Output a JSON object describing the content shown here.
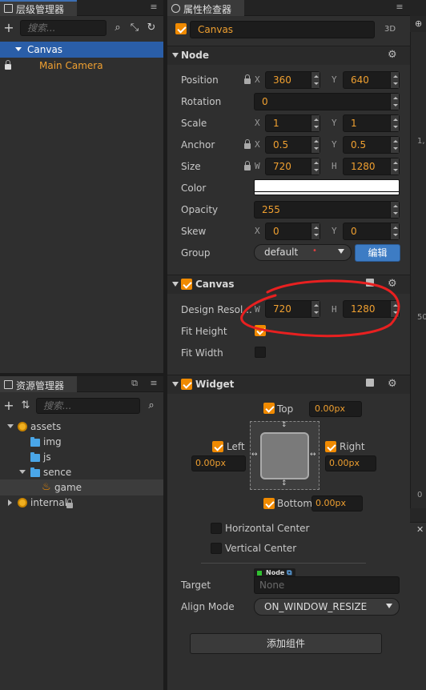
{
  "hierarchy": {
    "tab_title": "层级管理器",
    "search_placeholder": "搜索...",
    "nodes": [
      {
        "label": "Canvas"
      },
      {
        "label": "Main Camera"
      }
    ]
  },
  "assets": {
    "tab_title": "资源管理器",
    "search_placeholder": "搜索...",
    "items": [
      {
        "label": "assets"
      },
      {
        "label": "img"
      },
      {
        "label": "js"
      },
      {
        "label": "sence"
      },
      {
        "label": "game"
      },
      {
        "label": "internal"
      }
    ]
  },
  "inspector": {
    "tab_title": "属性检查器",
    "node_name": "Canvas",
    "mode_3d": "3D",
    "node_section": {
      "title": "Node",
      "position": {
        "label": "Position",
        "x": "360",
        "y": "640"
      },
      "rotation": {
        "label": "Rotation",
        "value": "0"
      },
      "scale": {
        "label": "Scale",
        "x": "1",
        "y": "1"
      },
      "anchor": {
        "label": "Anchor",
        "x": "0.5",
        "y": "0.5"
      },
      "size": {
        "label": "Size",
        "w": "720",
        "h": "1280"
      },
      "color": {
        "label": "Color",
        "value": "#ffffff"
      },
      "opacity": {
        "label": "Opacity",
        "value": "255"
      },
      "skew": {
        "label": "Skew",
        "x": "0",
        "y": "0"
      },
      "group": {
        "label": "Group",
        "value": "default",
        "edit_label": "编辑"
      }
    },
    "canvas_section": {
      "title": "Canvas",
      "design_resolution": {
        "label": "Design Resol...",
        "w": "720",
        "h": "1280"
      },
      "fit_height": {
        "label": "Fit Height",
        "checked": true
      },
      "fit_width": {
        "label": "Fit Width",
        "checked": false
      }
    },
    "widget_section": {
      "title": "Widget",
      "top": {
        "label": "Top",
        "value": "0.00px",
        "checked": true
      },
      "left": {
        "label": "Left",
        "value": "0.00px",
        "checked": true
      },
      "right": {
        "label": "Right",
        "value": "0.00px",
        "checked": true
      },
      "bottom": {
        "label": "Bottom",
        "value": "0.00px",
        "checked": true
      },
      "horizontal_center": {
        "label": "Horizontal Center",
        "checked": false
      },
      "vertical_center": {
        "label": "Vertical Center",
        "checked": false
      },
      "target": {
        "label": "Target",
        "tag": "Node",
        "value": "None"
      },
      "align_mode": {
        "label": "Align Mode",
        "value": "ON_WINDOW_RESIZE"
      }
    },
    "add_component_label": "添加组件"
  },
  "axis_labels": {
    "x": "X",
    "y": "Y",
    "w": "W",
    "h": "H"
  },
  "scene_ruler": {
    "tick_1": "1,",
    "tick_500": "50",
    "tick_0": "0"
  },
  "colors": {
    "accent": "#f08a00",
    "selection": "#2a5ea8",
    "edit_button": "#3d7cc4",
    "annotation_red": "#e82020"
  }
}
